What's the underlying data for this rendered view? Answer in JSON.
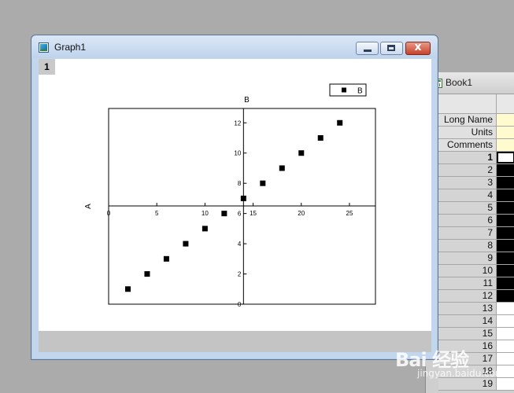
{
  "book": {
    "title": "Book1",
    "headers": [
      "Long Name",
      "Units",
      "Comments"
    ],
    "row_numbers": [
      "1",
      "2",
      "3",
      "4",
      "5",
      "6",
      "7",
      "8",
      "9",
      "10",
      "11",
      "12",
      "13",
      "14",
      "15",
      "16",
      "17",
      "18",
      "19"
    ]
  },
  "graph": {
    "title": "Graph1",
    "layer_label": "1",
    "close_glyph": "x"
  },
  "chart_data": {
    "type": "scatter",
    "title": "",
    "xlabel": "B",
    "ylabel": "A",
    "legend": {
      "entries": [
        "B"
      ],
      "placement": "top-right"
    },
    "series": [
      {
        "name": "B",
        "x": [
          2,
          4,
          6,
          8,
          10,
          12,
          14,
          16,
          18,
          20,
          22,
          24
        ],
        "y": [
          1,
          2,
          3,
          4,
          5,
          6,
          7,
          8,
          9,
          10,
          11,
          12
        ]
      }
    ],
    "xlim": [
      0,
      27.7
    ],
    "ylim": [
      0,
      12.95
    ],
    "x_ticks": [
      0,
      5,
      10,
      15,
      20,
      25
    ],
    "x_tick_labels": [
      "0",
      "5",
      "10",
      "15",
      "20",
      "25"
    ],
    "y_ticks": [
      0,
      2,
      4,
      6,
      8,
      10,
      12
    ],
    "y_tick_labels": [
      "0",
      "2",
      "4",
      "6",
      "8",
      "10",
      "12"
    ],
    "axis_crossing": {
      "x_axis_at_y": 6.5,
      "y_axis_at_x": 14
    },
    "grid": false,
    "marker": "square",
    "color": "#000000"
  },
  "watermark": {
    "main": "Bai 经验",
    "sub": "jingyan.baidu.com"
  }
}
